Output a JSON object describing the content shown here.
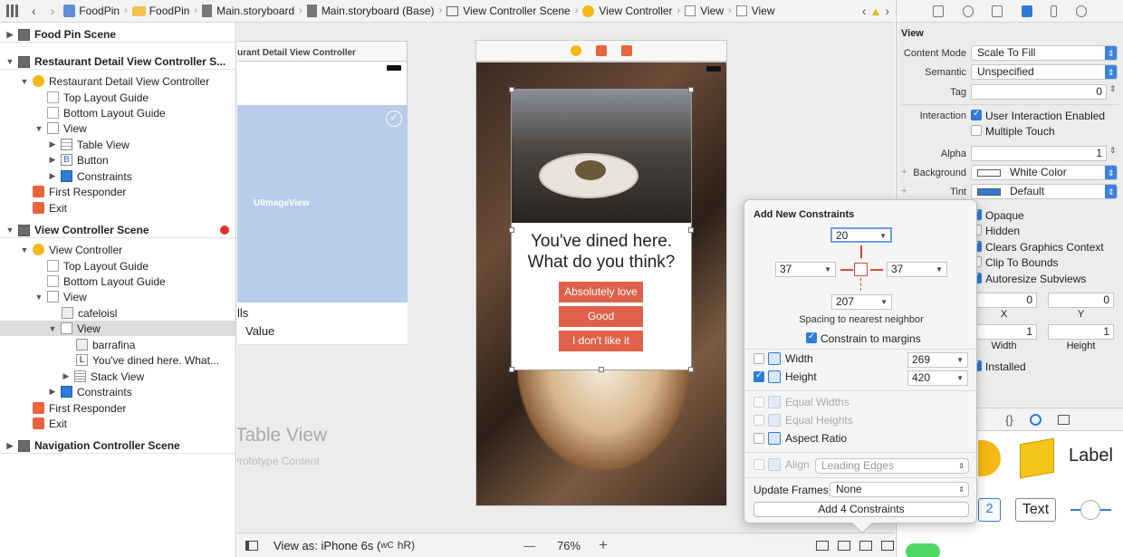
{
  "jumpbar": {
    "items": [
      "FoodPin",
      "FoodPin",
      "Main.storyboard",
      "Main.storyboard (Base)",
      "View Controller Scene",
      "View Controller",
      "View",
      "View"
    ]
  },
  "outline": {
    "rows": [
      {
        "label": "Food Pin Scene"
      },
      {
        "label": "Restaurant Detail View Controller S..."
      },
      {
        "label": "Restaurant Detail View Controller"
      },
      {
        "label": "Top Layout Guide"
      },
      {
        "label": "Bottom Layout Guide"
      },
      {
        "label": "View"
      },
      {
        "label": "Table View"
      },
      {
        "label": "Button"
      },
      {
        "label": "Constraints"
      },
      {
        "label": "First Responder"
      },
      {
        "label": "Exit"
      },
      {
        "label": "View Controller Scene"
      },
      {
        "label": "View Controller"
      },
      {
        "label": "Top Layout Guide"
      },
      {
        "label": "Bottom Layout Guide"
      },
      {
        "label": "View"
      },
      {
        "label": "cafeloisl"
      },
      {
        "label": "View"
      },
      {
        "label": "barrafina"
      },
      {
        "label": "You've dined here. What..."
      },
      {
        "label": "Stack View"
      },
      {
        "label": "Constraints"
      },
      {
        "label": "First Responder"
      },
      {
        "label": "Exit"
      },
      {
        "label": "Navigation Controller Scene"
      }
    ]
  },
  "canvas": {
    "left_scene_title": "urant Detail View Controller",
    "imageview_label": "UIImageView",
    "cells_text": "lls",
    "value_text": "Value",
    "tableview_title": "Table View",
    "tableview_sub": "Prototype Content",
    "dialog_title": "You've dined here. What do you think?",
    "btn_love": "Absolutely love it!",
    "btn_good": "Good",
    "btn_dislike": "I don't like it"
  },
  "bottombar": {
    "view_as": "View as: iPhone 6s (",
    "wc": "wC",
    "hr": "hR)",
    "minus": "—",
    "zoom": "76%",
    "plus": "+"
  },
  "inspector": {
    "section": "View",
    "content_mode_label": "Content Mode",
    "content_mode": "Scale To Fill",
    "semantic_label": "Semantic",
    "semantic": "Unspecified",
    "tag_label": "Tag",
    "tag": "0",
    "interaction_label": "Interaction",
    "user_interaction": "User Interaction Enabled",
    "multiple_touch": "Multiple Touch",
    "alpha_label": "Alpha",
    "alpha": "1",
    "background_label": "Background",
    "background": "White Color",
    "tint_label": "Tint",
    "tint": "Default",
    "opaque": "Opaque",
    "hidden": "Hidden",
    "clears": "Clears Graphics Context",
    "clip": "Clip To Bounds",
    "autoresize": "Autoresize Subviews",
    "x_val": "0",
    "y_val": "0",
    "x_label": "X",
    "y_label": "Y",
    "width_val": "1",
    "height_val": "1",
    "width_label": "Width",
    "height_label": "Height",
    "installed": "Installed",
    "lib_label": "Label",
    "lib_text": "Text",
    "lib_num": "2"
  },
  "popover": {
    "title": "Add New Constraints",
    "top": "20",
    "left": "37",
    "right": "37",
    "bottom": "207",
    "spacing_label": "Spacing to nearest neighbor",
    "constrain_margins": "Constrain to margins",
    "width_label": "Width",
    "width_val": "269",
    "height_label": "Height",
    "height_val": "420",
    "equal_widths": "Equal Widths",
    "equal_heights": "Equal Heights",
    "aspect_ratio": "Aspect Ratio",
    "align_label": "Align",
    "align_val": "Leading Edges",
    "update_frames_label": "Update Frames",
    "update_frames_val": "None",
    "add_button": "Add 4 Constraints"
  },
  "colors": {
    "accent": "#2e7cd6",
    "dialog_button": "#e0614a",
    "selection": "#dcdcdc"
  }
}
